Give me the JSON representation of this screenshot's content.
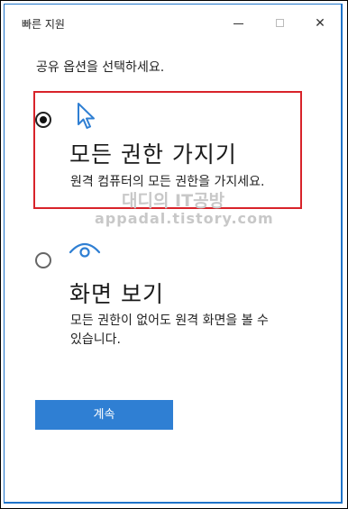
{
  "window": {
    "title": "빠른 지원",
    "close_glyph": "✕"
  },
  "prompt": "공유 옵션을 선택하세요.",
  "options": [
    {
      "title": "모든 권한 가지기",
      "description": "원격 컴퓨터의 모든 권한을 가지세요.",
      "selected": true,
      "icon": "cursor-icon"
    },
    {
      "title": "화면 보기",
      "description_lines": [
        "모든 권한이 없어도 원격 화면을 볼 수",
        "있습니다."
      ],
      "selected": false,
      "icon": "eye-icon"
    }
  ],
  "watermark": {
    "line1": "대디의 IT공방",
    "line2": "appadal.tistory.com"
  },
  "continue_label": "계속",
  "colors": {
    "accent": "#2f7fd3",
    "highlight": "#d8232a",
    "window_border": "#1e73c9"
  }
}
